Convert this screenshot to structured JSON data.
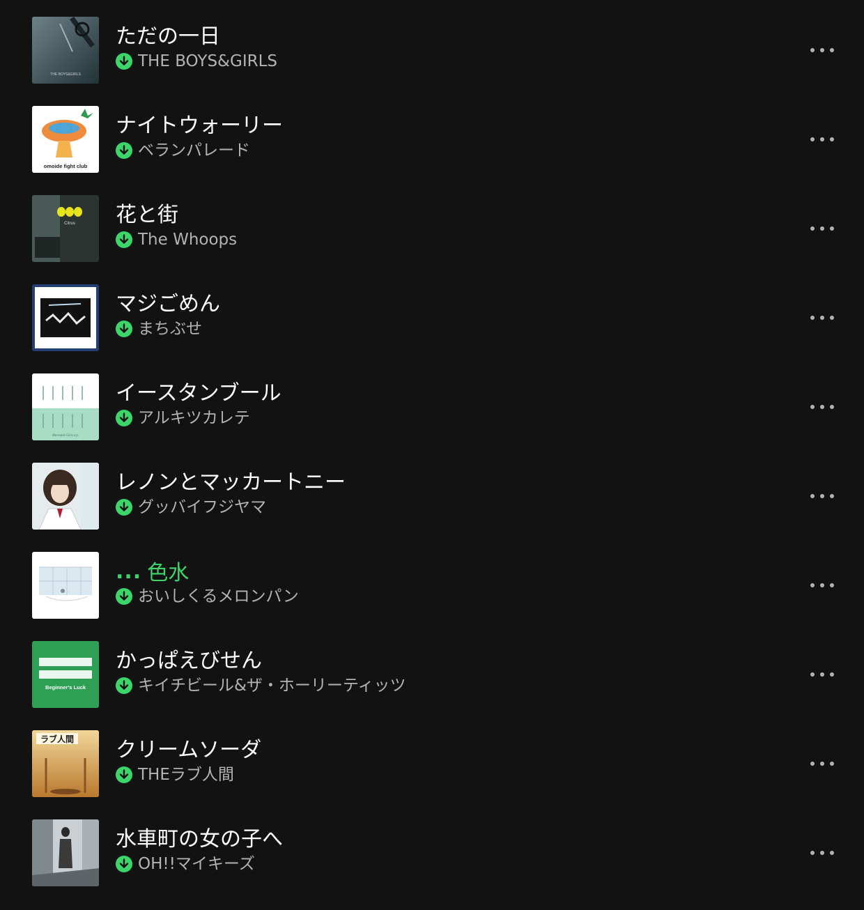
{
  "accent_color": "#3dd46b",
  "background_color": "#121212",
  "tracks": [
    {
      "title": "ただの一日",
      "artist": "THE BOYS&GIRLS",
      "downloaded": true,
      "playing": false
    },
    {
      "title": "ナイトウォーリー",
      "artist": "ベランパレード",
      "downloaded": true,
      "playing": false
    },
    {
      "title": "花と街",
      "artist": "The Whoops",
      "downloaded": true,
      "playing": false
    },
    {
      "title": "マジごめん",
      "artist": "まちぶせ",
      "downloaded": true,
      "playing": false
    },
    {
      "title": "イースタンブール",
      "artist": "アルキツカレテ",
      "downloaded": true,
      "playing": false
    },
    {
      "title": "レノンとマッカートニー",
      "artist": "グッバイフジヤマ",
      "downloaded": true,
      "playing": false
    },
    {
      "title": "色水",
      "artist": "おいしくるメロンパン",
      "downloaded": true,
      "playing": true
    },
    {
      "title": "かっぱえびせん",
      "artist": "キイチビール&ザ・ホーリーティッツ",
      "downloaded": true,
      "playing": false
    },
    {
      "title": "クリームソーダ",
      "artist": "THEラブ人間",
      "downloaded": true,
      "playing": false
    },
    {
      "title": "水車町の女の子へ",
      "artist": "OH!!マイキーズ",
      "downloaded": true,
      "playing": false
    }
  ],
  "covers": [
    {
      "name": "album-cover-the-boys-and-girls",
      "text": "THE BOYS&GIRLS"
    },
    {
      "name": "album-cover-bellang-parade",
      "text": "omoide fight club"
    },
    {
      "name": "album-cover-the-whoops",
      "text": "Citrus"
    },
    {
      "name": "album-cover-machibuse",
      "text": ""
    },
    {
      "name": "album-cover-arukitsukarete",
      "text": "Mermaid Girls e.p."
    },
    {
      "name": "album-cover-goodbye-fujiyama",
      "text": ""
    },
    {
      "name": "album-cover-oishikuru-melonpan",
      "text": ""
    },
    {
      "name": "album-cover-kiichi-beer",
      "text": "Beginner's Luck"
    },
    {
      "name": "album-cover-the-love-ningen",
      "text": "ラブ人間"
    },
    {
      "name": "album-cover-oh-my-keys",
      "text": ""
    }
  ],
  "icons": {
    "download": "download-circle-icon",
    "more": "more-options-icon",
    "now_playing": "equalizer-icon"
  },
  "now_playing_indicator": "..."
}
